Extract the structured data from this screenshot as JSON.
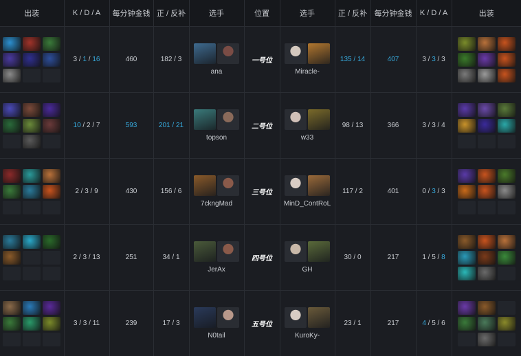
{
  "headers": {
    "items_left": "出装",
    "kda_left": "K / D / A",
    "gpm_left": "每分钟金钱",
    "lhd_left": "正 / 反补",
    "player_left": "选手",
    "role": "位置",
    "player_right": "选手",
    "lhd_right": "正 / 反补",
    "gpm_right": "每分钟金钱",
    "kda_right": "K / D / A",
    "items_right": "出装"
  },
  "rows": [
    {
      "role": "一号位",
      "left": {
        "name": "ana",
        "kda": [
          "3",
          "1",
          "16"
        ],
        "kda_hi": [
          false,
          true,
          true
        ],
        "gpm": "460",
        "gpm_hi": false,
        "lhd": [
          "182",
          "3"
        ],
        "lhd_hi": false,
        "hero": "#3e6a8f",
        "face": "#7a4c45",
        "items": [
          "#2c8fcf",
          "#a0332a",
          "#3a7a3a",
          "#4a3aa0",
          "#2f2f8f",
          "#2d4e9a",
          "#8a8a8a",
          "",
          ""
        ]
      },
      "right": {
        "name": "Miracle-",
        "kda": [
          "3",
          "3",
          "3"
        ],
        "kda_hi": [
          false,
          true,
          false
        ],
        "gpm": "407",
        "gpm_hi": true,
        "lhd": [
          "135",
          "14"
        ],
        "lhd_hi": true,
        "hero": "#b2772f",
        "face": "#d4c8be",
        "items": [
          "#7a8c2a",
          "#b8713a",
          "#c7531e",
          "#3a7a2a",
          "#6a3aa8",
          "#c7531e",
          "#7a7a7a",
          "#9a9a9a",
          "#c7531e"
        ]
      }
    },
    {
      "role": "二号位",
      "left": {
        "name": "topson",
        "kda": [
          "10",
          "2",
          "7"
        ],
        "kda_hi": [
          true,
          false,
          false
        ],
        "gpm": "593",
        "gpm_hi": true,
        "lhd": [
          "201",
          "21"
        ],
        "lhd_hi": true,
        "hero": "#3a7a7a",
        "face": "#8a6a5a",
        "items": [
          "#4a4ab8",
          "#7a4a3a",
          "#4a2a9a",
          "#2a6a3a",
          "#6a8a3a",
          "#6a3a3a",
          "",
          "#5a5a5a",
          ""
        ]
      },
      "right": {
        "name": "w33",
        "kda": [
          "3",
          "3",
          "4"
        ],
        "kda_hi": [
          false,
          false,
          false
        ],
        "gpm": "366",
        "gpm_hi": false,
        "lhd": [
          "98",
          "13"
        ],
        "lhd_hi": false,
        "hero": "#7a6a2a",
        "face": "#d0c0b8",
        "items": [
          "#5a3aa8",
          "#6a4aa8",
          "#5a7a3a",
          "#c8922a",
          "#3a2a9a",
          "#2aa8a8",
          "",
          "",
          ""
        ]
      }
    },
    {
      "role": "三号位",
      "left": {
        "name": "7ckngMad",
        "kda": [
          "2",
          "3",
          "9"
        ],
        "kda_hi": [
          false,
          false,
          false
        ],
        "gpm": "430",
        "gpm_hi": false,
        "lhd": [
          "156",
          "6"
        ],
        "lhd_hi": false,
        "hero": "#8a5a2a",
        "face": "#8a5a4a",
        "items": [
          "#8a2a2a",
          "#2a9a9a",
          "#b8713a",
          "#3a7a3a",
          "#2a7a9a",
          "#c7531e",
          "",
          "",
          ""
        ]
      },
      "right": {
        "name": "MinD_ContRoL",
        "kda": [
          "0",
          "3",
          "3"
        ],
        "kda_hi": [
          false,
          true,
          false
        ],
        "gpm": "401",
        "gpm_hi": false,
        "lhd": [
          "117",
          "2"
        ],
        "lhd_hi": false,
        "hero": "#9a6a3a",
        "face": "#d8ccc4",
        "items": [
          "#5a3aa8",
          "#c7531e",
          "#4a7a2a",
          "#c86a1a",
          "#c7531e",
          "#8a8a8a",
          "",
          "",
          ""
        ]
      }
    },
    {
      "role": "四号位",
      "left": {
        "name": "JerAx",
        "kda": [
          "2",
          "3",
          "13"
        ],
        "kda_hi": [
          false,
          false,
          false
        ],
        "gpm": "251",
        "gpm_hi": false,
        "lhd": [
          "34",
          "1"
        ],
        "lhd_hi": false,
        "hero": "#4a5a3a",
        "face": "#8a5a4a",
        "items": [
          "#2a7a9a",
          "#2aa8c8",
          "#2a6a2a",
          "#8a5a2a",
          "",
          "",
          "",
          "",
          ""
        ]
      },
      "right": {
        "name": "GH",
        "kda": [
          "1",
          "5",
          "8"
        ],
        "kda_hi": [
          false,
          false,
          true
        ],
        "gpm": "217",
        "gpm_hi": false,
        "lhd": [
          "30",
          "0"
        ],
        "lhd_hi": false,
        "hero": "#5a6a3a",
        "face": "#c8b8a8",
        "items": [
          "#8a5a2a",
          "#c7531e",
          "#b8713a",
          "#2a9ab8",
          "#7a3a1a",
          "#3a8a3a",
          "#2ab8b8",
          "#6a6a6a",
          ""
        ]
      }
    },
    {
      "role": "五号位",
      "left": {
        "name": "N0tail",
        "kda": [
          "3",
          "3",
          "11"
        ],
        "kda_hi": [
          false,
          false,
          false
        ],
        "gpm": "239",
        "gpm_hi": false,
        "lhd": [
          "17",
          "3"
        ],
        "lhd_hi": false,
        "hero": "#2a3a5a",
        "face": "#b8988a",
        "items": [
          "#8a6a4a",
          "#2a7ab8",
          "#5a2a9a",
          "#3a7a3a",
          "#2a9a6a",
          "#7a8a2a",
          "",
          "",
          ""
        ]
      },
      "right": {
        "name": "KuroKy-",
        "kda": [
          "4",
          "5",
          "6"
        ],
        "kda_hi": [
          true,
          false,
          false
        ],
        "gpm": "217",
        "gpm_hi": false,
        "lhd": [
          "23",
          "1"
        ],
        "lhd_hi": false,
        "hero": "#6a5a3a",
        "face": "#d8ccc4",
        "items": [
          "#6a3aa8",
          "#8a5a2a",
          "",
          "#3a7a3a",
          "#4a7a5a",
          "#8a8a2a",
          "",
          "#6a6a6a",
          ""
        ]
      }
    }
  ]
}
